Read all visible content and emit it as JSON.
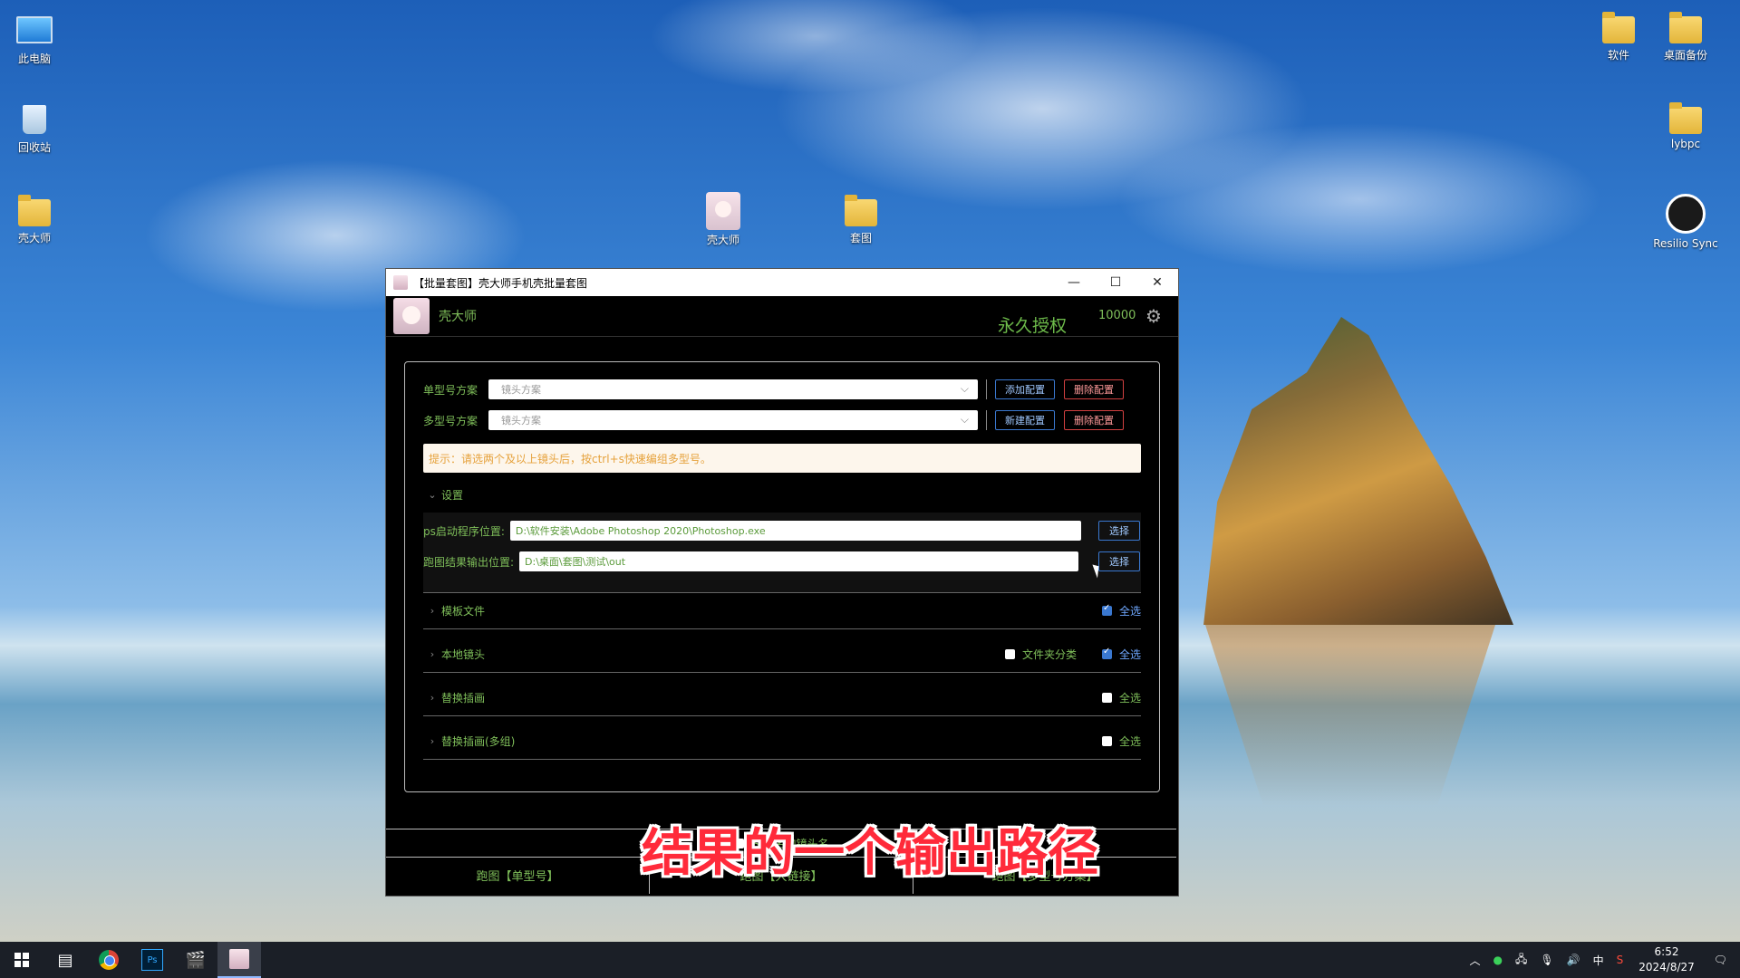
{
  "desktop": {
    "icons": [
      {
        "label": "此电脑",
        "type": "pc"
      },
      {
        "label": "回收站",
        "type": "bin"
      },
      {
        "label": "壳大师",
        "type": "folder"
      },
      {
        "label": "壳大师",
        "type": "avatar"
      },
      {
        "label": "套图",
        "type": "folder"
      },
      {
        "label": "软件",
        "type": "folder"
      },
      {
        "label": "桌面备份",
        "type": "folder"
      },
      {
        "label": "lybpc",
        "type": "folder"
      },
      {
        "label": "Resilio Sync",
        "type": "sync"
      }
    ]
  },
  "window": {
    "title": "【批量套图】壳大师手机壳批量套图",
    "controls": {
      "minimize": "—",
      "maximize": "☐",
      "close": "✕"
    }
  },
  "header": {
    "brand": "壳大师",
    "license": "永久授权",
    "quota": "10000",
    "settings_icon": "⚙"
  },
  "schemes": {
    "single_label": "单型号方案",
    "single_placeholder": "镜头方案",
    "add_config": "添加配置",
    "delete_config": "删除配置",
    "multi_label": "多型号方案",
    "multi_placeholder": "镜头方案",
    "new_config": "新建配置",
    "delete_config_2": "删除配置",
    "tip": "提示：请选两个及以上镜头后，按ctrl+s快速编组多型号。"
  },
  "settings": {
    "title": "设置",
    "ps_label": "ps启动程序位置:",
    "ps_path": "D:\\软件安装\\Adobe Photoshop 2020\\Photoshop.exe",
    "out_label": "跑图结果输出位置:",
    "out_path": "D:\\桌面\\套图\\测试\\out",
    "choose": "选择"
  },
  "sections": {
    "templates": {
      "title": "模板文件",
      "select_all": "全选"
    },
    "local_lens": {
      "title": "本地镜头",
      "folder_classify": "文件夹分类",
      "select_all": "全选"
    },
    "replace": {
      "title": "替换插画",
      "select_all": "全选"
    },
    "replace_multi": {
      "title": "替换插画(多组)",
      "select_all": "全选"
    }
  },
  "footer": {
    "sku_label": "SKU名加镜头名",
    "run_single": "跑图【单型号】",
    "run_link": "跑图【大链接】",
    "run_multi": "跑图【多型号方案】"
  },
  "subtitle": "结果的一个输出路径",
  "taskbar": {
    "tray_ime": "中",
    "time": "6:52",
    "date": "2024/8/27"
  }
}
